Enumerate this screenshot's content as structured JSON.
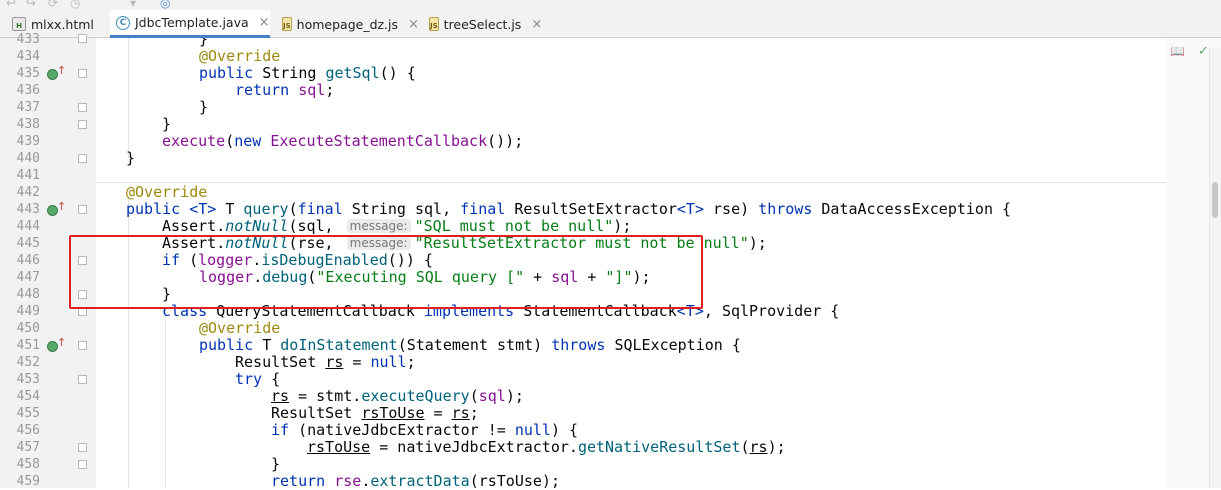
{
  "tabs": [
    {
      "label": "mlxx.html",
      "icon": "html-file-icon"
    },
    {
      "label": "JdbcTemplate.java",
      "icon": "java-class-icon"
    },
    {
      "label": "homepage_dz.js",
      "icon": "js-file-icon"
    },
    {
      "label": "treeSelect.js",
      "icon": "js-file-icon"
    }
  ],
  "file_icon_letters": {
    "html": "H",
    "java": "C",
    "js": "JS"
  },
  "close_glyph": "×",
  "gutter": {
    "line_numbers": [
      "433",
      "434",
      "435",
      "436",
      "437",
      "438",
      "439",
      "440",
      "441",
      "442",
      "443",
      "444",
      "445",
      "446",
      "447",
      "448",
      "449",
      "450",
      "451",
      "452",
      "453",
      "454",
      "455",
      "456",
      "457",
      "458",
      "459"
    ]
  },
  "code": {
    "l433": "}",
    "l434_ann": "@Override",
    "l435": {
      "kw": "public",
      "type": "String",
      "meth": "getSql",
      "rest": "() {"
    },
    "l436": {
      "kw": "return",
      "fld": "sql",
      "rest": ";"
    },
    "l437": "}",
    "l438": "}",
    "l439": {
      "call": "execute",
      "p1": "(",
      "kw": "new",
      "cls": "ExecuteStatementCallback",
      "rest": "());"
    },
    "l440": "}",
    "l442_ann": "@Override",
    "l443": {
      "kw1": "public",
      "tp": "<T>",
      "t": "T",
      "meth": "query",
      "p1": "(",
      "kw2": "final",
      "type": "String",
      "param1": "sql",
      "c1": ", ",
      "kw3": "final",
      "type2": "ResultSetExtractor",
      "tp2": "<T>",
      "param2": "rse",
      "c2": ") ",
      "kw4": "throws",
      "exc": "DataAccessException",
      "rest": " {"
    },
    "l444": {
      "cls": "Assert",
      "dot": ".",
      "meth": "notNull",
      "p1": "(sql, ",
      "hint": "message:",
      "str": "\"SQL must not be null\"",
      "rest": ");"
    },
    "l445": {
      "cls": "Assert",
      "dot": ".",
      "meth": "notNull",
      "p1": "(rse, ",
      "hint": "message:",
      "str": "\"ResultSetExtractor must not be null\"",
      "rest": ");"
    },
    "l446": {
      "kw": "if",
      "p1": " (",
      "fld": "logger",
      "dot": ".",
      "meth": "isDebugEnabled",
      "rest": "()) {"
    },
    "l447": {
      "fld": "logger",
      "dot": ".",
      "meth": "debug",
      "p1": "(",
      "str1": "\"Executing SQL query [\"",
      "plus1": " + ",
      "var": "sql",
      "plus2": " + ",
      "str2": "\"]\"",
      "rest": ");"
    },
    "l448": "}",
    "l449": {
      "kw": "class",
      "cls": "QueryStatementCallback",
      "kw2": "implements",
      "iface": "StatementCallback",
      "tp": "<T>",
      "c": ", ",
      "iface2": "SqlProvider",
      "rest": " {"
    },
    "l450_ann": "@Override",
    "l451": {
      "kw": "public",
      "t": "T",
      "meth": "doInStatement",
      "p1": "(Statement stmt) ",
      "kw2": "throws",
      "exc": "SQLException",
      "rest": " {"
    },
    "l452": {
      "type": "ResultSet",
      "var": "rs",
      "p1": " = ",
      "kw": "null",
      "rest": ";"
    },
    "l453": {
      "kw": "try",
      "rest": " {"
    },
    "l454": {
      "var": "rs",
      "p1": " = stmt.",
      "meth": "executeQuery",
      "p2": "(",
      "fld": "sql",
      "rest": ");"
    },
    "l455": {
      "type": "ResultSet",
      "var": "rsToUse",
      "p1": " = ",
      "var2": "rs",
      "rest": ";"
    },
    "l456": {
      "kw": "if",
      "p1": " (nativeJdbcExtractor != ",
      "kw2": "null",
      "rest": ") {"
    },
    "l457": {
      "var": "rsToUse",
      "p1": " = nativeJdbcExtractor.",
      "meth": "getNativeResultSet",
      "p2": "(",
      "var2": "rs",
      "rest": ");"
    },
    "l458": "}",
    "l459": {
      "kw": "return",
      "fld": "rse",
      "dot": ".",
      "meth": "extractData",
      "rest": "(rsToUse);"
    }
  },
  "colors": {
    "keyword": "#0033b3",
    "annotation": "#9e880d",
    "string": "#067d17",
    "field": "#871094",
    "highlight_box": "#e0201f"
  }
}
